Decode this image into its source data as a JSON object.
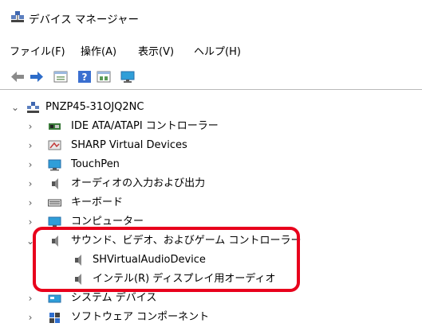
{
  "window": {
    "title": "デバイス マネージャー"
  },
  "menu": [
    "ファイル(F)",
    "操作(A)",
    "表示(V)",
    "ヘルプ(H)"
  ],
  "toolbar": {
    "icons": [
      "back-arrow-icon",
      "forward-arrow-icon",
      "properties-icon",
      "help-icon",
      "update-driver-icon",
      "monitor-icon"
    ]
  },
  "tree": {
    "root": "PNZP45-31OJQ2NC",
    "items": [
      {
        "label": "IDE ATA/ATAPI コントローラー",
        "icon": "ide-controller-icon",
        "expander": "›"
      },
      {
        "label": "SHARP Virtual Devices",
        "icon": "virtual-devices-icon",
        "expander": "›"
      },
      {
        "label": "TouchPen",
        "icon": "touchpen-icon",
        "expander": "›"
      },
      {
        "label": "オーディオの入力および出力",
        "icon": "speaker-icon",
        "expander": "›"
      },
      {
        "label": "キーボード",
        "icon": "keyboard-icon",
        "expander": "›"
      },
      {
        "label": "コンピューター",
        "icon": "computer-icon",
        "expander": "›"
      },
      {
        "label": "サウンド、ビデオ、およびゲーム コントローラー",
        "icon": "speaker-icon",
        "expander": "⌄",
        "children": [
          "SHVirtualAudioDevice",
          "インテル(R) ディスプレイ用オーディオ"
        ]
      },
      {
        "label": "システム デバイス",
        "icon": "system-devices-icon",
        "expander": "›"
      },
      {
        "label": "ソフトウェア コンポーネント",
        "icon": "software-component-icon",
        "expander": "›"
      }
    ]
  },
  "colors": {
    "highlight": "#e8001c",
    "accent": "#1e6fd9"
  }
}
